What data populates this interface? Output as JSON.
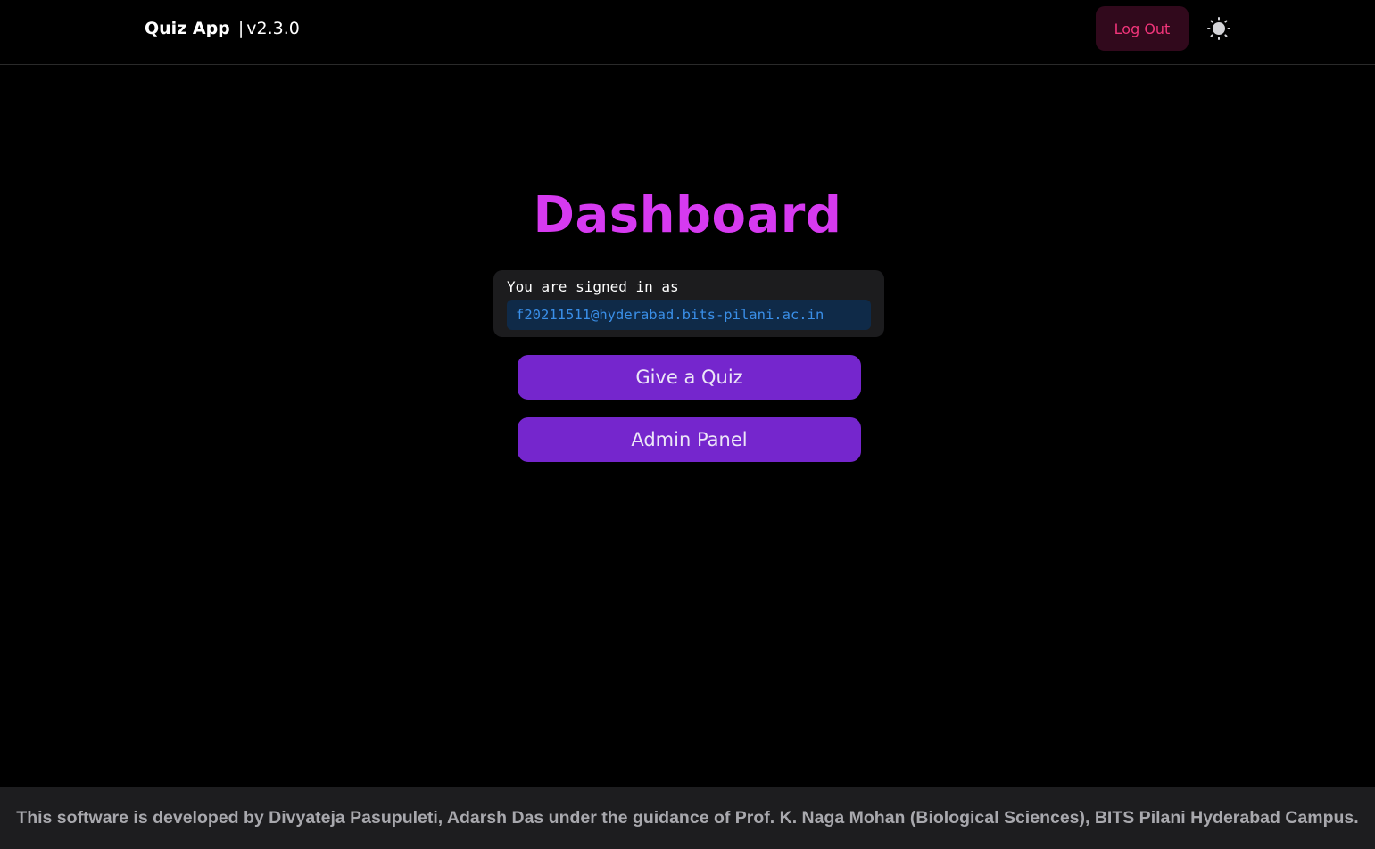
{
  "header": {
    "app_name": "Quiz App",
    "separator": "|",
    "version": "v2.3.0",
    "logout_label": "Log Out",
    "theme_toggle_icon": "sun-icon"
  },
  "main": {
    "title": "Dashboard",
    "signin_label": "You are signed in as",
    "email": "f20211511@hyderabad.bits-pilani.ac.in",
    "buttons": [
      {
        "label": "Give a Quiz"
      },
      {
        "label": "Admin Panel"
      }
    ]
  },
  "footer": {
    "text": "This software is developed by Divyateja Pasupuleti, Adarsh Das under the guidance of Prof. K. Naga Mohan (Biological Sciences), BITS Pilani Hyderabad Campus."
  },
  "colors": {
    "background": "#000000",
    "title": "#d63af0",
    "primary_button": "#7526cd",
    "logout_text": "#f0357a",
    "logout_bg": "#31091c",
    "email_text": "#3a8fe8",
    "email_bg": "#0f2a48",
    "footer_bg": "#1d1d1f"
  }
}
